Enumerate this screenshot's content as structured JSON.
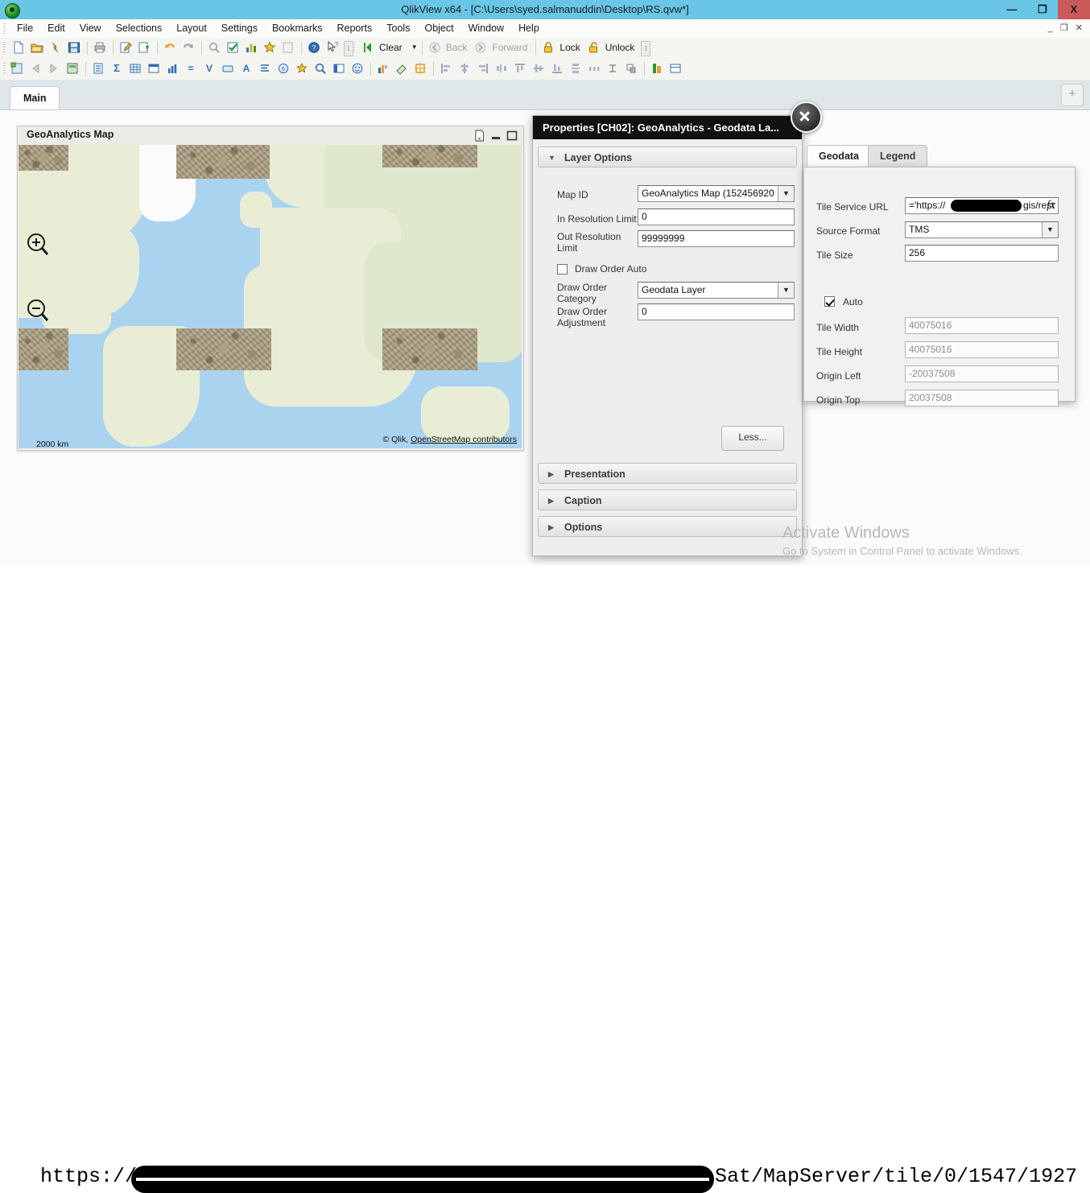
{
  "window": {
    "title": "QlikView x64 - [C:\\Users\\syed.salmanuddin\\Desktop\\RS.qvw*]",
    "logo_icon": "qlikview-logo-icon",
    "minimize": "—",
    "maximize": "❐",
    "close": "X"
  },
  "menu": {
    "items": [
      {
        "label": "File"
      },
      {
        "label": "Edit"
      },
      {
        "label": "View"
      },
      {
        "label": "Selections"
      },
      {
        "label": "Layout"
      },
      {
        "label": "Settings"
      },
      {
        "label": "Bookmarks"
      },
      {
        "label": "Reports"
      },
      {
        "label": "Tools"
      },
      {
        "label": "Object"
      },
      {
        "label": "Window"
      },
      {
        "label": "Help"
      }
    ],
    "doc_buttons": "_ ❐ ✕"
  },
  "toolbar_main": {
    "buttons": [
      {
        "name": "new-document-icon",
        "glyph": "🗋"
      },
      {
        "name": "open-document-icon",
        "glyph": "📂"
      },
      {
        "name": "reload-icon",
        "glyph": "↯"
      },
      {
        "name": "save-icon",
        "glyph": "💾"
      },
      {
        "name": "print-icon",
        "glyph": "🖨"
      },
      {
        "name": "edit-script-icon",
        "glyph": "📝"
      },
      {
        "name": "reduce-data-icon",
        "glyph": "⇩"
      },
      {
        "name": "undo-icon",
        "glyph": "↩"
      },
      {
        "name": "redo-icon",
        "glyph": "↪"
      },
      {
        "name": "search-icon",
        "glyph": "🔍"
      },
      {
        "name": "current-selections-icon",
        "glyph": "☑"
      },
      {
        "name": "chart-wizard-icon",
        "glyph": "📊"
      },
      {
        "name": "favorites-icon",
        "glyph": "★"
      },
      {
        "name": "design-grid-icon",
        "glyph": "▤"
      },
      {
        "name": "help-icon",
        "glyph": "?"
      },
      {
        "name": "context-help-icon",
        "glyph": "↖"
      }
    ],
    "clear_label": "Clear",
    "back_label": "Back",
    "forward_label": "Forward",
    "lock_label": "Lock",
    "unlock_label": "Unlock",
    "overflow_glyph": "⁞"
  },
  "toolbar_design": {
    "buttons": [
      {
        "name": "new-sheet-icon",
        "glyph": "▦"
      },
      {
        "name": "sheet-back-icon",
        "glyph": "◅"
      },
      {
        "name": "sheet-forward-icon",
        "glyph": "▻"
      },
      {
        "name": "sheet-properties-icon",
        "glyph": "▩"
      },
      {
        "name": "list-box-icon",
        "glyph": "☰"
      },
      {
        "name": "statistics-box-icon",
        "glyph": "Σ"
      },
      {
        "name": "multi-box-icon",
        "glyph": "▦"
      },
      {
        "name": "table-box-icon",
        "glyph": "▤"
      },
      {
        "name": "chart-icon",
        "glyph": "▥"
      },
      {
        "name": "input-box-icon",
        "glyph": "="
      },
      {
        "name": "current-selections-box-icon",
        "glyph": "V"
      },
      {
        "name": "button-icon",
        "glyph": "▭"
      },
      {
        "name": "text-object-icon",
        "glyph": "A"
      },
      {
        "name": "line-arrow-icon",
        "glyph": "≡"
      },
      {
        "name": "slider-calendar-icon",
        "glyph": "◎"
      },
      {
        "name": "bookmark-object-icon",
        "glyph": "★"
      },
      {
        "name": "search-object-icon",
        "glyph": "🔍"
      },
      {
        "name": "container-icon",
        "glyph": "▣"
      },
      {
        "name": "custom-object-icon",
        "glyph": "☺"
      },
      {
        "name": "chart-properties-icon",
        "glyph": "📈"
      },
      {
        "name": "clear-format-icon",
        "glyph": "🧹"
      },
      {
        "name": "grid-snap-icon",
        "glyph": "✛"
      },
      {
        "name": "align-left-icon",
        "glyph": "▯"
      },
      {
        "name": "align-center-icon",
        "glyph": "▯"
      },
      {
        "name": "align-right-icon",
        "glyph": "▯"
      },
      {
        "name": "distribute-h-icon",
        "glyph": "▯"
      },
      {
        "name": "align-top-icon",
        "glyph": "▯"
      },
      {
        "name": "align-middle-icon",
        "glyph": "▯"
      },
      {
        "name": "align-bottom-icon",
        "glyph": "▯"
      },
      {
        "name": "distribute-v-icon",
        "glyph": "▯"
      },
      {
        "name": "space-h-icon",
        "glyph": "▯"
      },
      {
        "name": "space-v-icon",
        "glyph": "▯"
      },
      {
        "name": "resize-icon",
        "glyph": "▯"
      },
      {
        "name": "extension-object-icon",
        "glyph": "🔧"
      },
      {
        "name": "server-object-icon",
        "glyph": "▤"
      }
    ]
  },
  "sheet_tabs": {
    "tabs": [
      {
        "label": "Main",
        "active": true
      }
    ],
    "add_label": "+"
  },
  "map_object": {
    "title": "GeoAnalytics Map",
    "caption_icons": [
      {
        "name": "clear-selections-icon",
        "glyph": "⌫"
      },
      {
        "name": "minimize-icon",
        "glyph": "—"
      },
      {
        "name": "maximize-icon",
        "glyph": "❐"
      }
    ],
    "zoom_in_icon": "zoom-in-icon",
    "zoom_out_icon": "zoom-out-icon",
    "scale_label": "2000 km",
    "attribution_prefix": "© Qlik, ",
    "attribution_link": "OpenStreetMap contributors"
  },
  "properties_dialog": {
    "title": "Properties [CH02]: GeoAnalytics - Geodata La...",
    "close_icon": "close-icon",
    "sections": [
      {
        "label": "Layer Options",
        "expanded": true
      },
      {
        "label": "Presentation",
        "expanded": false
      },
      {
        "label": "Caption",
        "expanded": false
      },
      {
        "label": "Options",
        "expanded": false
      }
    ],
    "layer_options": {
      "map_id_label": "Map ID",
      "map_id_value": "GeoAnalytics Map (152456920",
      "in_resolution_label": "In Resolution Limit",
      "in_resolution_value": "0",
      "out_resolution_label": "Out Resolution Limit",
      "out_resolution_value": "99999999",
      "draw_order_auto_label": "Draw Order Auto",
      "draw_order_auto_checked": false,
      "draw_order_category_label": "Draw Order Category",
      "draw_order_category_value": "Geodata Layer",
      "draw_order_adjustment_label": "Draw Order Adjustment",
      "draw_order_adjustment_value": "0"
    },
    "less_button": "Less..."
  },
  "geodata_panel": {
    "tabs": [
      {
        "label": "Geodata",
        "active": true
      },
      {
        "label": "Legend",
        "active": false
      }
    ],
    "fields": {
      "tile_service_url_label": "Tile Service URL",
      "tile_service_url_value": "='https://",
      "tile_service_url_value_tail": "gis/rest",
      "fx_label": "fx",
      "source_format_label": "Source Format",
      "source_format_value": "TMS",
      "tile_size_label": "Tile Size",
      "tile_size_value": "256",
      "auto_label": "Auto",
      "auto_checked": true,
      "tile_width_label": "Tile Width",
      "tile_width_value": "40075016",
      "tile_height_label": "Tile Height",
      "tile_height_value": "40075016",
      "origin_left_label": "Origin Left",
      "origin_left_value": "-20037508",
      "origin_top_label": "Origin Top",
      "origin_top_value": "20037508"
    }
  },
  "watermark": {
    "title": "Activate Windows",
    "subtitle": "Go to System in Control Panel to activate Windows."
  },
  "bottom_url": {
    "prefix": "https://",
    "suffix": "Sat/MapServer/tile/0/1547/1927"
  },
  "colors": {
    "title_bar": "#6ac6e6",
    "close_button": "#c85a57",
    "dialog_title_bg": "#111111",
    "tab_row_bg": "#dfe7ea",
    "map_water": "#aad3f0",
    "map_land": "#e9edd6"
  }
}
